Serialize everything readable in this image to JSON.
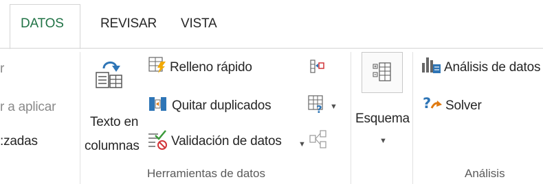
{
  "tabs": [
    {
      "label": "DATOS",
      "active": true
    },
    {
      "label": "REVISAR",
      "active": false
    },
    {
      "label": "VISTA",
      "active": false
    }
  ],
  "left_partial": {
    "line1": "r",
    "line2": "r a aplicar",
    "line3": ":zadas"
  },
  "herramientas": {
    "texto_en_line1": "Texto en",
    "texto_en_line2": "columnas",
    "relleno": "Relleno rápido",
    "quitar": "Quitar duplicados",
    "validacion": "Validación de datos",
    "group_label": "Herramientas de datos"
  },
  "esquema": {
    "label": "Esquema"
  },
  "analisis": {
    "analisis_datos": "Análisis de datos",
    "solver": "Solver",
    "group_label": "Análisis"
  },
  "icons": {
    "texto_en_columnas": "text-to-columns-icon",
    "relleno": "flash-fill-icon",
    "quitar": "remove-duplicates-icon",
    "validacion": "data-validation-icon",
    "consolidar": "consolidate-icon",
    "analisis_hipotetico": "what-if-analysis-icon",
    "relaciones": "relationships-icon",
    "esquema": "outline-icon",
    "analisis_datos": "data-analysis-icon",
    "solver": "solver-icon"
  },
  "colors": {
    "active_tab": "#217346",
    "text": "#262626",
    "accent_blue": "#2e75b6",
    "accent_red": "#d13438"
  }
}
